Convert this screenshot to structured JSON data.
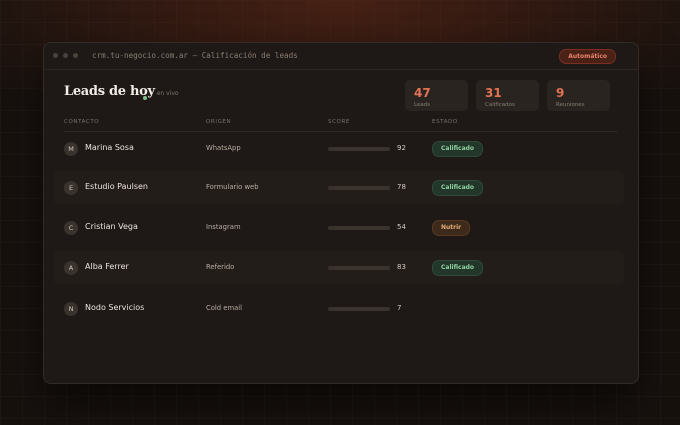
{
  "browser": {
    "url": "crm.tu-negocio.com.ar — Calificación de leads",
    "mode_badge": "Automático"
  },
  "header": {
    "title": "Leads de hoy",
    "live_label": "en vivo"
  },
  "stats": [
    {
      "value": "47",
      "label": "Leads"
    },
    {
      "value": "31",
      "label": "Calificados"
    },
    {
      "value": "9",
      "label": "Reuniones"
    }
  ],
  "table": {
    "columns": [
      "CONTACTO",
      "ORIGEN",
      "SCORE",
      "ESTADO"
    ],
    "rows": [
      {
        "initial": "M",
        "name": "Marina Sosa",
        "origin": "WhatsApp",
        "score": 92,
        "score_text": "92",
        "status": "Calificado",
        "status_kind": "good"
      },
      {
        "initial": "E",
        "name": "Estudio Paulsen",
        "origin": "Formulario web",
        "score": 78,
        "score_text": "78",
        "status": "Calificado",
        "status_kind": "good"
      },
      {
        "initial": "C",
        "name": "Cristian Vega",
        "origin": "Instagram",
        "score": 54,
        "score_text": "54",
        "status": "Nutrir",
        "status_kind": "warm"
      },
      {
        "initial": "A",
        "name": "Alba Ferrer",
        "origin": "Referido",
        "score": 83,
        "score_text": "83",
        "status": "Calificado",
        "status_kind": "good"
      },
      {
        "initial": "N",
        "name": "Nodo Servicios",
        "origin": "Cold email",
        "score": 7,
        "score_text": "7",
        "status": "",
        "status_kind": ""
      }
    ]
  },
  "colors": {
    "accent": "#e06447",
    "qualified": "#8fd2a0",
    "nurture": "#e2b07c"
  }
}
